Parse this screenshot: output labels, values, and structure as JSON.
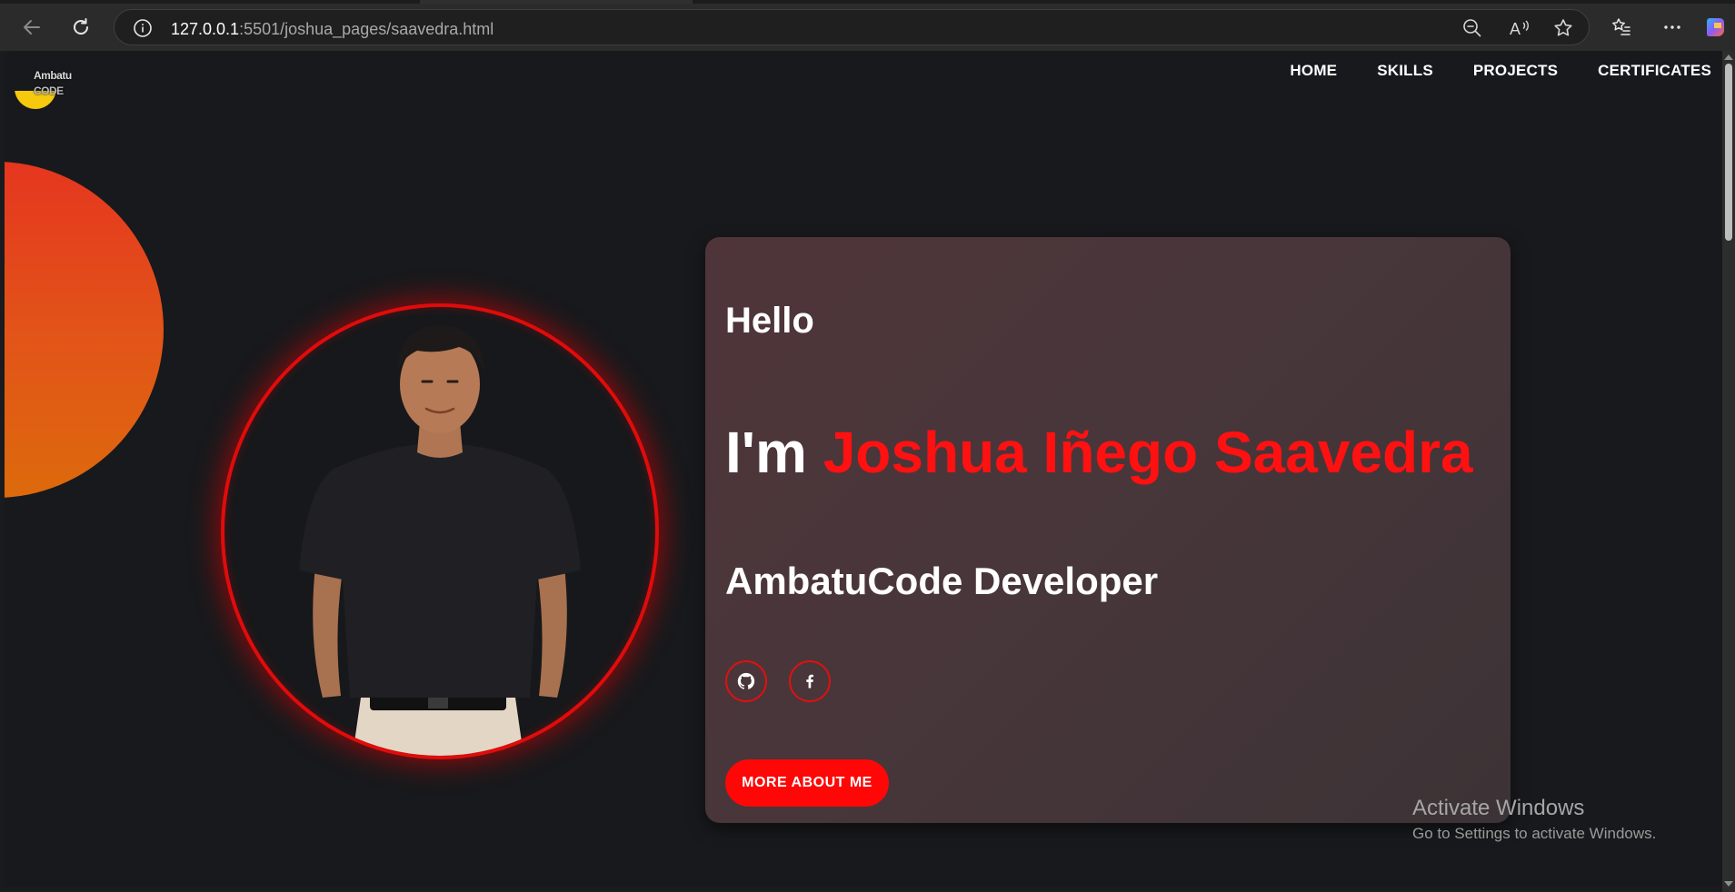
{
  "browser": {
    "url_host": "127.0.0.1",
    "url_rest": ":5501/joshua_pages/saavedra.html",
    "icons": [
      "back-icon",
      "refresh-icon",
      "info-icon",
      "zoom-out-icon",
      "read-aloud-icon",
      "favorite-star-icon",
      "favorites-list-icon",
      "more-icon",
      "copilot-icon"
    ]
  },
  "site": {
    "logo_line1": "Ambatu",
    "logo_line2": "CODE",
    "nav": [
      "HOME",
      "SKILLS",
      "PROJECTS",
      "CERTIFICATES"
    ]
  },
  "hero": {
    "greeting": "Hello",
    "intro_prefix": "I'm",
    "name": "Joshua Iñego Saavedra",
    "role": "AmbatuCode Developer",
    "cta_label": "MORE ABOUT ME",
    "social": [
      "github-icon",
      "facebook-icon"
    ]
  },
  "os_watermark": {
    "title": "Activate Windows",
    "subtitle": "Go to Settings to activate Windows."
  },
  "colors": {
    "accent_red": "#ff1111",
    "background": "#18191c",
    "card": "#4a3539",
    "blob_top": "#e5361f",
    "blob_bottom": "#dd6a0c"
  }
}
